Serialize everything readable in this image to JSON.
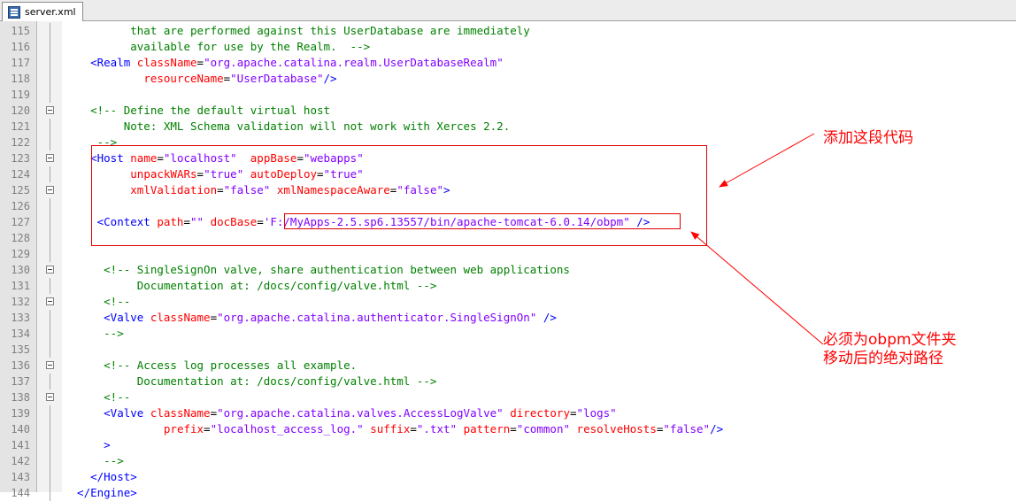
{
  "tab": {
    "title": "server.xml",
    "icon": "xml-file-icon"
  },
  "lines": [
    {
      "n": "115",
      "tokens": [
        [
          "c",
          "          that are performed against this UserDatabase are immediately"
        ]
      ]
    },
    {
      "n": "116",
      "tokens": [
        [
          "c",
          "          available for use by the Realm.  -->"
        ]
      ]
    },
    {
      "n": "117",
      "tokens": [
        [
          "t",
          "    <Realm "
        ],
        [
          "a",
          "className"
        ],
        [
          "x",
          "="
        ],
        [
          "v",
          "\"org.apache.catalina.realm.UserDatabaseRealm\""
        ]
      ]
    },
    {
      "n": "118",
      "tokens": [
        [
          "x",
          "            "
        ],
        [
          "a",
          "resourceName"
        ],
        [
          "x",
          "="
        ],
        [
          "v",
          "\"UserDatabase\""
        ],
        [
          "t",
          "/>"
        ]
      ]
    },
    {
      "n": "119",
      "tokens": []
    },
    {
      "n": "120",
      "fold": true,
      "tokens": [
        [
          "c",
          "    <!-- Define the default virtual host"
        ]
      ]
    },
    {
      "n": "121",
      "tokens": [
        [
          "c",
          "         Note: XML Schema validation will not work with Xerces 2.2."
        ]
      ]
    },
    {
      "n": "122",
      "tokens": [
        [
          "c",
          "     -->"
        ]
      ]
    },
    {
      "n": "123",
      "fold": true,
      "tokens": [
        [
          "t",
          "    <Host "
        ],
        [
          "a",
          "name"
        ],
        [
          "x",
          "="
        ],
        [
          "v",
          "\"localhost\""
        ],
        [
          "x",
          "  "
        ],
        [
          "a",
          "appBase"
        ],
        [
          "x",
          "="
        ],
        [
          "v",
          "\"webapps\""
        ]
      ]
    },
    {
      "n": "124",
      "tokens": [
        [
          "x",
          "          "
        ],
        [
          "a",
          "unpackWARs"
        ],
        [
          "x",
          "="
        ],
        [
          "v",
          "\"true\""
        ],
        [
          "x",
          " "
        ],
        [
          "a",
          "autoDeploy"
        ],
        [
          "x",
          "="
        ],
        [
          "v",
          "\"true\""
        ]
      ]
    },
    {
      "n": "125",
      "fold": true,
      "tokens": [
        [
          "x",
          "          "
        ],
        [
          "a",
          "xmlValidation"
        ],
        [
          "x",
          "="
        ],
        [
          "v",
          "\"false\""
        ],
        [
          "x",
          " "
        ],
        [
          "a",
          "xmlNamespaceAware"
        ],
        [
          "x",
          "="
        ],
        [
          "v",
          "\"false\""
        ],
        [
          "t",
          ">"
        ]
      ]
    },
    {
      "n": "126",
      "tokens": []
    },
    {
      "n": "127",
      "tokens": [
        [
          "t",
          "     <Context "
        ],
        [
          "a",
          "path"
        ],
        [
          "x",
          "="
        ],
        [
          "v",
          "\"\""
        ],
        [
          "x",
          " "
        ],
        [
          "a",
          "docBase"
        ],
        [
          "x",
          "="
        ],
        [
          "v",
          "'F:/MyApps-2.5.sp6.13557/bin/apache-tomcat-6.0.14/obpm\""
        ],
        [
          "x",
          " "
        ],
        [
          "t",
          "/>"
        ]
      ]
    },
    {
      "n": "128",
      "tokens": []
    },
    {
      "n": "129",
      "tokens": []
    },
    {
      "n": "130",
      "fold": true,
      "tokens": [
        [
          "c",
          "      <!-- SingleSignOn valve, share authentication between web applications"
        ]
      ]
    },
    {
      "n": "131",
      "tokens": [
        [
          "c",
          "           Documentation at: /docs/config/valve.html -->"
        ]
      ]
    },
    {
      "n": "132",
      "fold": true,
      "tokens": [
        [
          "c",
          "      <!--"
        ]
      ]
    },
    {
      "n": "133",
      "tokens": [
        [
          "t",
          "      <Valve "
        ],
        [
          "a",
          "className"
        ],
        [
          "x",
          "="
        ],
        [
          "v",
          "\"org.apache.catalina.authenticator.SingleSignOn\""
        ],
        [
          "x",
          " "
        ],
        [
          "t",
          "/>"
        ]
      ]
    },
    {
      "n": "134",
      "tokens": [
        [
          "c",
          "      -->"
        ]
      ]
    },
    {
      "n": "135",
      "tokens": []
    },
    {
      "n": "136",
      "fold": true,
      "tokens": [
        [
          "c",
          "      <!-- Access log processes all example."
        ]
      ]
    },
    {
      "n": "137",
      "tokens": [
        [
          "c",
          "           Documentation at: /docs/config/valve.html -->"
        ]
      ]
    },
    {
      "n": "138",
      "fold": true,
      "tokens": [
        [
          "c",
          "      <!--"
        ]
      ]
    },
    {
      "n": "139",
      "tokens": [
        [
          "t",
          "      <Valve "
        ],
        [
          "a",
          "className"
        ],
        [
          "x",
          "="
        ],
        [
          "v",
          "\"org.apache.catalina.valves.AccessLogValve\""
        ],
        [
          "x",
          " "
        ],
        [
          "a",
          "directory"
        ],
        [
          "x",
          "="
        ],
        [
          "v",
          "\"logs\""
        ]
      ]
    },
    {
      "n": "140",
      "tokens": [
        [
          "x",
          "               "
        ],
        [
          "a",
          "prefix"
        ],
        [
          "x",
          "="
        ],
        [
          "v",
          "\"localhost_access_log.\""
        ],
        [
          "x",
          " "
        ],
        [
          "a",
          "suffix"
        ],
        [
          "x",
          "="
        ],
        [
          "v",
          "\".txt\""
        ],
        [
          "x",
          " "
        ],
        [
          "a",
          "pattern"
        ],
        [
          "x",
          "="
        ],
        [
          "v",
          "\"common\""
        ],
        [
          "x",
          " "
        ],
        [
          "a",
          "resolveHosts"
        ],
        [
          "x",
          "="
        ],
        [
          "v",
          "\"false\""
        ],
        [
          "t",
          "/>"
        ]
      ]
    },
    {
      "n": "141",
      "tokens": [
        [
          "t",
          "      >"
        ]
      ]
    },
    {
      "n": "142",
      "tokens": [
        [
          "c",
          "      -->"
        ]
      ]
    },
    {
      "n": "143",
      "tokens": [
        [
          "t",
          "    </Host>"
        ]
      ]
    },
    {
      "n": "144",
      "tokens": [
        [
          "t",
          "  </Engine>"
        ]
      ]
    }
  ],
  "annotations": {
    "add_this_code": "添加这段代码",
    "must_be_path_line1": "必须为obpm文件夹",
    "must_be_path_line2": "移动后的绝对路径"
  },
  "colors": {
    "comment": "#008000",
    "tag": "#0000ff",
    "attribute": "#ff0000",
    "value": "#8000ff",
    "annotation": "#ff0000"
  }
}
